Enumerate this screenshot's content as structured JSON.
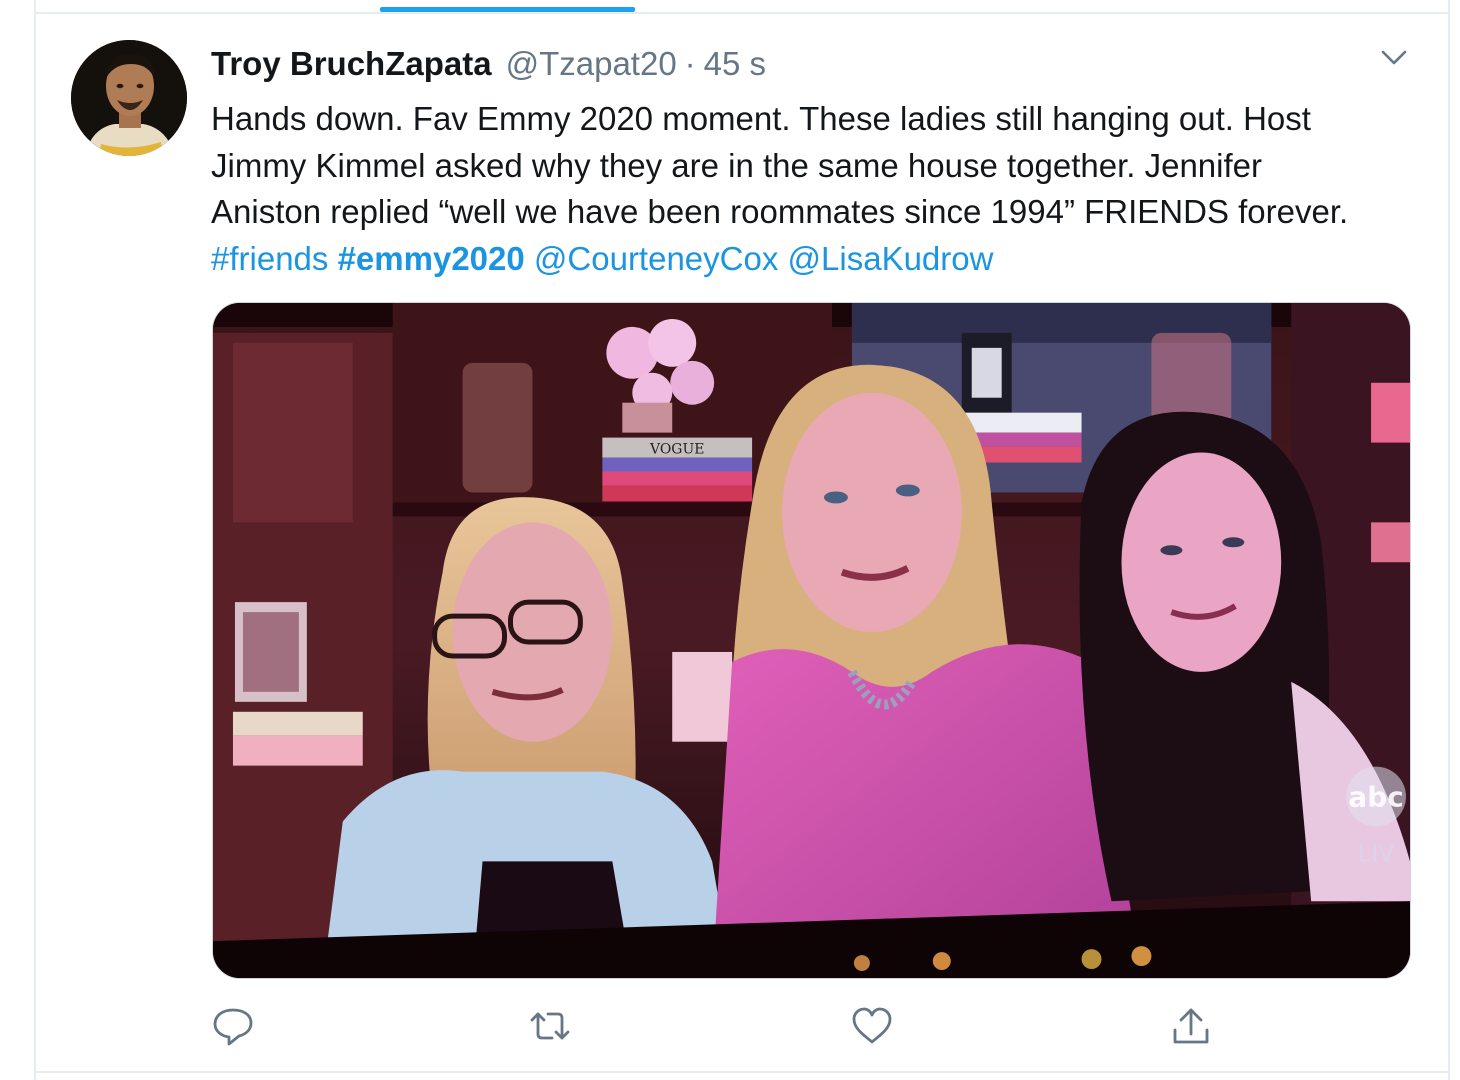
{
  "tweet": {
    "author_name": "Troy BruchZapata",
    "author_handle": "@Tzapat20",
    "separator": "·",
    "timestamp": "45 s",
    "text_lines": [
      "Hands down. Fav Emmy 2020 moment. These ladies still hanging out. Host",
      "Jimmy Kimmel asked why they are in the same house together. Jennifer",
      "Aniston replied “well we have been roommates since 1994” FRIENDS forever."
    ],
    "tags": {
      "friends": "#friends",
      "emmy": "#emmy2020",
      "mention_cox": "@CourteneyCox",
      "mention_kudrow": "@LisaKudrow"
    },
    "media": {
      "vogue_label": "VOGUE",
      "network_logo": "abc",
      "live_label": "LIV"
    }
  },
  "actions": {
    "reply_icon": "reply-icon",
    "retweet_icon": "retweet-icon",
    "like_icon": "heart-icon",
    "share_icon": "share-icon"
  },
  "colors": {
    "link": "#1b95e0",
    "secondary_text": "#657786",
    "tab_indicator": "#1da1f2",
    "border": "#e6ecf0"
  }
}
